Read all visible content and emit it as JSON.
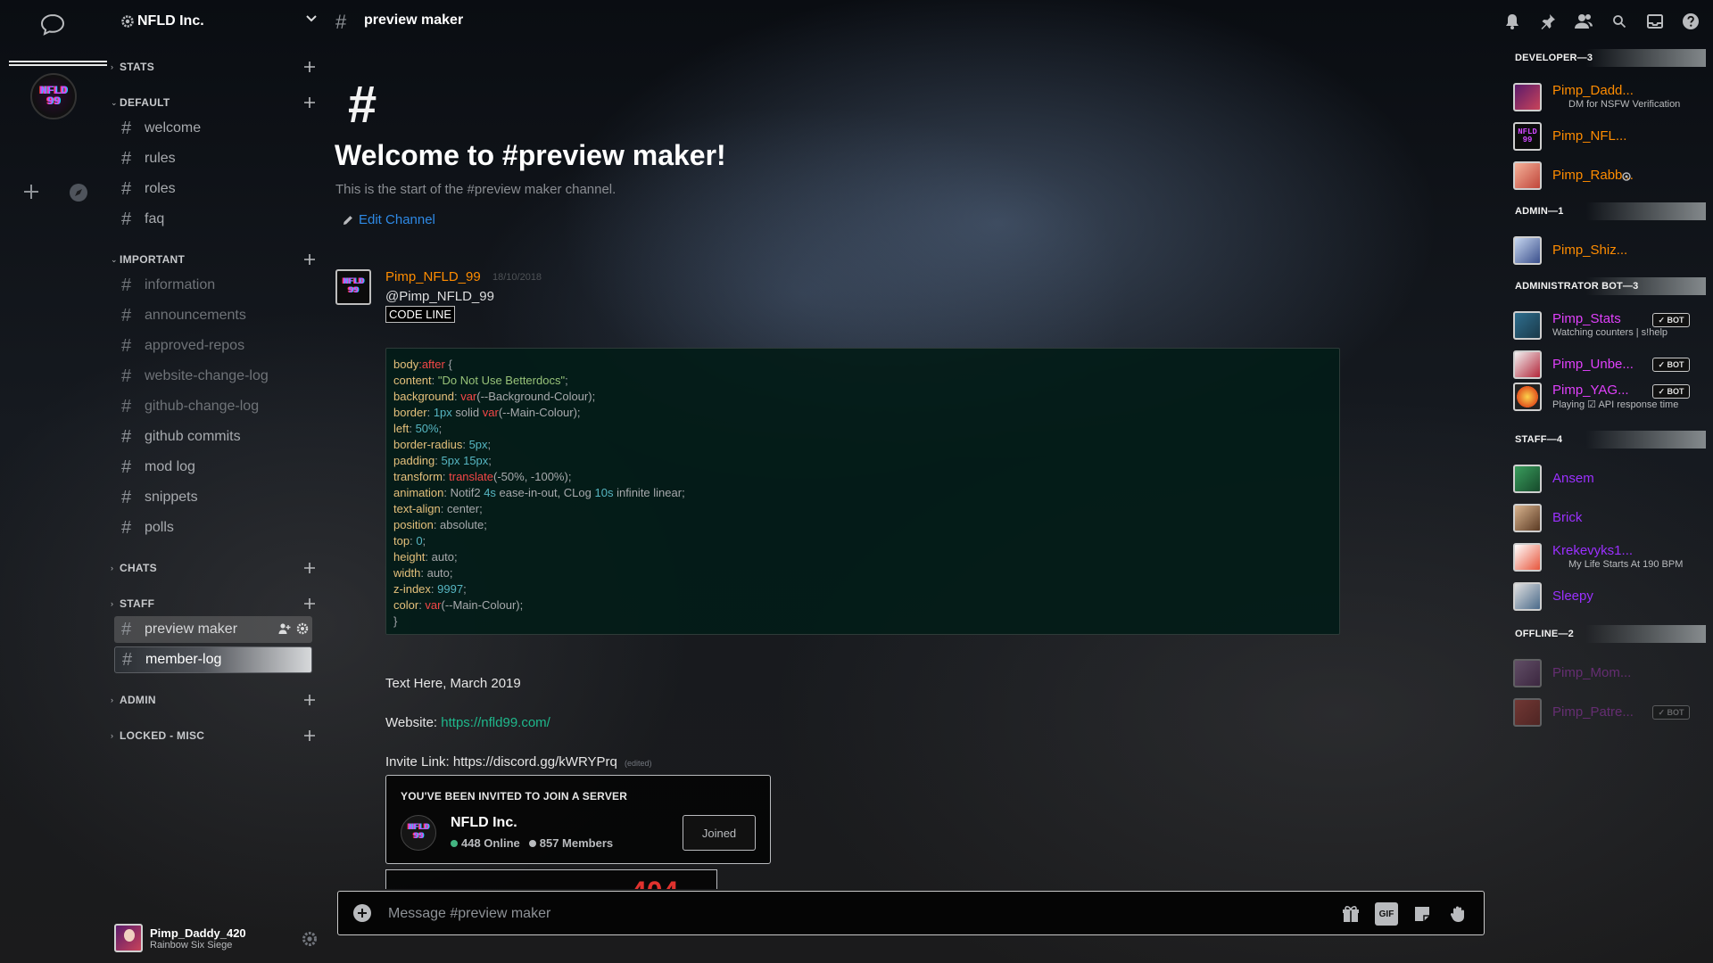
{
  "server": {
    "name": "NFLD Inc.",
    "icon": "gear-icon"
  },
  "guild_bar": {
    "guild_icon_text": "NFLD\n99"
  },
  "categories": {
    "stats": "STATS",
    "default": "DEFAULT",
    "important": "IMPORTANT",
    "chats": "CHATS",
    "staff": "STAFF",
    "admin": "ADMIN",
    "locked": "LOCKED - MISC"
  },
  "channels": {
    "default": [
      "welcome",
      "rules",
      "roles",
      "faq"
    ],
    "important": [
      "information",
      "announcements",
      "approved-repos",
      "website-change-log",
      "github-change-log",
      "github commits",
      "mod log",
      "snippets",
      "polls"
    ],
    "staff": [
      "preview maker",
      "member-log"
    ]
  },
  "user": {
    "name": "Pimp_Daddy_420",
    "activity": "Rainbow Six Siege"
  },
  "topbar": {
    "channel": "preview maker",
    "icons": [
      "bell-icon",
      "pin-icon",
      "members-icon",
      "search-icon",
      "inbox-icon",
      "help-icon"
    ]
  },
  "welcome": {
    "title": "Welcome to #preview maker!",
    "subtitle": "This is the start of the #preview maker channel.",
    "edit": "Edit Channel"
  },
  "message": {
    "author": "Pimp_NFLD_99",
    "time": "18/10/2018",
    "mention": "@Pimp_NFLD_99",
    "code_label": "CODE LINE",
    "text_date": "Text Here, March 2019",
    "website_label": "Website:",
    "website_url": "https://nfld99.com/",
    "invite_label": "Invite Link:",
    "invite_url": "https://discord.gg/kWRYPrq",
    "edited": "(edited)"
  },
  "code": [
    "body:after {",
    "content: \"Do Not Use Betterdocs\";",
    "background: var(--Background-Colour);",
    "border: 1px solid var(--Main-Colour);",
    "left: 50%;",
    "border-radius: 5px;",
    "padding: 5px 15px;",
    "transform: translate(-50%, -100%);",
    "animation: Notif2 4s ease-in-out, CLog 10s infinite linear;",
    "text-align: center;",
    "position: absolute;",
    "top: 0;",
    "height: auto;",
    "width: auto;",
    "z-index: 9997;",
    "color: var(--Main-Colour);",
    "}"
  ],
  "invite": {
    "heading": "YOU'VE BEEN INVITED TO JOIN A SERVER",
    "server": "NFLD Inc.",
    "online": "448 Online",
    "members": "857 Members",
    "button": "Joined",
    "partial_number": "404",
    "online_color": "#43b581",
    "members_color": "#b9bbbe"
  },
  "composer": {
    "placeholder": "Message #preview maker"
  },
  "members": {
    "roles": {
      "developer": "DEVELOPER—3",
      "admin": "ADMIN—1",
      "bot": "ADMINISTRATOR BOT—3",
      "staff": "STAFF—4",
      "offline": "OFFLINE—2"
    },
    "developer": [
      {
        "name": "Pimp_Dadd...",
        "status": "DM for NSFW Verification",
        "color": "#ff8c00"
      },
      {
        "name": "Pimp_NFL...",
        "status": "",
        "color": "#ff8c00"
      },
      {
        "name": "Pimp_Rabb...",
        "status": "",
        "color": "#ff8c00"
      }
    ],
    "admin": [
      {
        "name": "Pimp_Shiz...",
        "color": "#ff8c00"
      }
    ],
    "bots": [
      {
        "name": "Pimp_Stats",
        "status": "Watching counters | s!help",
        "color": "#e040fb",
        "tag": "✓ BOT"
      },
      {
        "name": "Pimp_Unbe...",
        "status": "",
        "color": "#e040fb",
        "tag": "✓ BOT"
      },
      {
        "name": "Pimp_YAG...",
        "status": "Playing ☑ API response time",
        "color": "#e040fb",
        "tag": "✓ BOT"
      }
    ],
    "staff": [
      {
        "name": "Ansem",
        "status": "",
        "color": "#9b30ff"
      },
      {
        "name": "Brick",
        "status": "",
        "color": "#9b30ff"
      },
      {
        "name": "Krekevyks1...",
        "status": "My Life Starts At 190 BPM",
        "color": "#9b30ff"
      },
      {
        "name": "Sleepy",
        "status": "",
        "color": "#9b30ff"
      }
    ],
    "offline": [
      {
        "name": "Pimp_Mom...",
        "color": "#e040fb"
      },
      {
        "name": "Pimp_Patre...",
        "color": "#e040fb",
        "tag": "✓ BOT"
      }
    ]
  }
}
